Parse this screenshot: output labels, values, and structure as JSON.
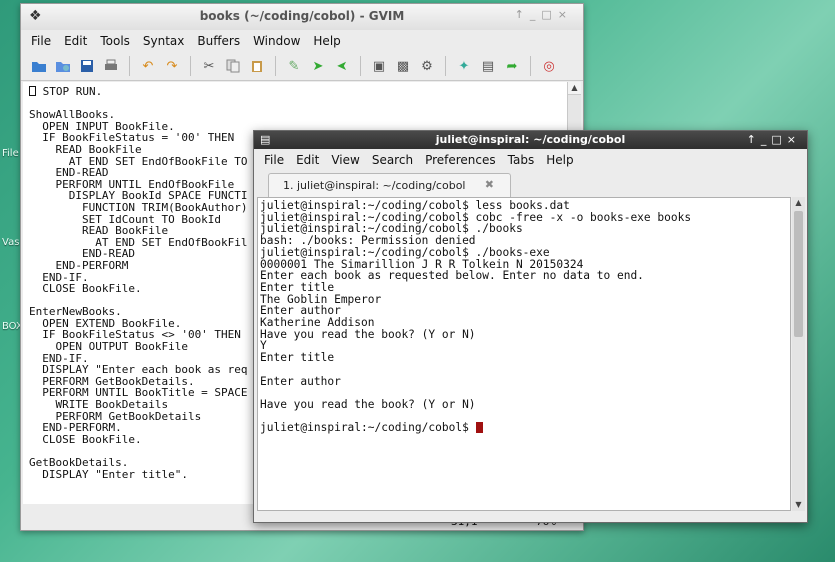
{
  "desktop": {
    "labels": [
      "File",
      "Vas",
      "BOX"
    ]
  },
  "gvim": {
    "title": "books (~/coding/cobol) - GVIM",
    "menu": [
      "File",
      "Edit",
      "Tools",
      "Syntax",
      "Buffers",
      "Window",
      "Help"
    ],
    "toolbar_icons": [
      "open-icon",
      "save-session-icon",
      "save-icon",
      "print-icon",
      "undo-icon",
      "redo-icon",
      "cut-icon",
      "copy-icon",
      "paste-icon",
      "replace-icon",
      "forward-icon",
      "back-icon",
      "load-session-icon",
      "save-session2-icon",
      "run-script-icon",
      "make-icon",
      "tag-icon",
      "jump-tag-icon",
      "help-icon"
    ],
    "lines": [
      " STOP RUN.",
      "",
      "ShowAllBooks.",
      "  OPEN INPUT BookFile.",
      "  IF BookFileStatus = '00' THEN",
      "    READ BookFile",
      "      AT END SET EndOfBookFile TO",
      "    END-READ",
      "    PERFORM UNTIL EndOfBookFile",
      "      DISPLAY BookId SPACE FUNCTI",
      "        FUNCTION TRIM(BookAuthor)",
      "        SET IdCount TO BookId",
      "        READ BookFile",
      "          AT END SET EndOfBookFil",
      "        END-READ",
      "    END-PERFORM",
      "  END-IF.",
      "  CLOSE BookFile.",
      "",
      "EnterNewBooks.",
      "  OPEN EXTEND BookFile.",
      "  IF BookFileStatus <> '00' THEN",
      "    OPEN OUTPUT BookFile",
      "  END-IF.",
      "  DISPLAY \"Enter each book as req",
      "  PERFORM GetBookDetails.",
      "  PERFORM UNTIL BookTitle = SPACE",
      "    WRITE BookDetails",
      "    PERFORM GetBookDetails",
      "  END-PERFORM.",
      "  CLOSE BookFile.",
      "",
      "GetBookDetails.",
      "  DISPLAY \"Enter title\"."
    ],
    "status_pos": "31,1",
    "status_pct": "76%"
  },
  "terminal": {
    "title": "juliet@inspiral: ~/coding/cobol",
    "menu": [
      "File",
      "Edit",
      "View",
      "Search",
      "Preferences",
      "Tabs",
      "Help"
    ],
    "tab_label": "1. juliet@inspiral: ~/coding/cobol",
    "lines": [
      "juliet@inspiral:~/coding/cobol$ less books.dat",
      "juliet@inspiral:~/coding/cobol$ cobc -free -x -o books-exe books",
      "juliet@inspiral:~/coding/cobol$ ./books",
      "bash: ./books: Permission denied",
      "juliet@inspiral:~/coding/cobol$ ./books-exe",
      "0000001 The Simarillion J R R Tolkein N 20150324",
      "Enter each book as requested below. Enter no data to end.",
      "Enter title",
      "The Goblin Emperor",
      "Enter author",
      "Katherine Addison",
      "Have you read the book? (Y or N)",
      "Y",
      "Enter title",
      "",
      "Enter author",
      "",
      "Have you read the book? (Y or N)",
      "",
      "juliet@inspiral:~/coding/cobol$ "
    ]
  }
}
